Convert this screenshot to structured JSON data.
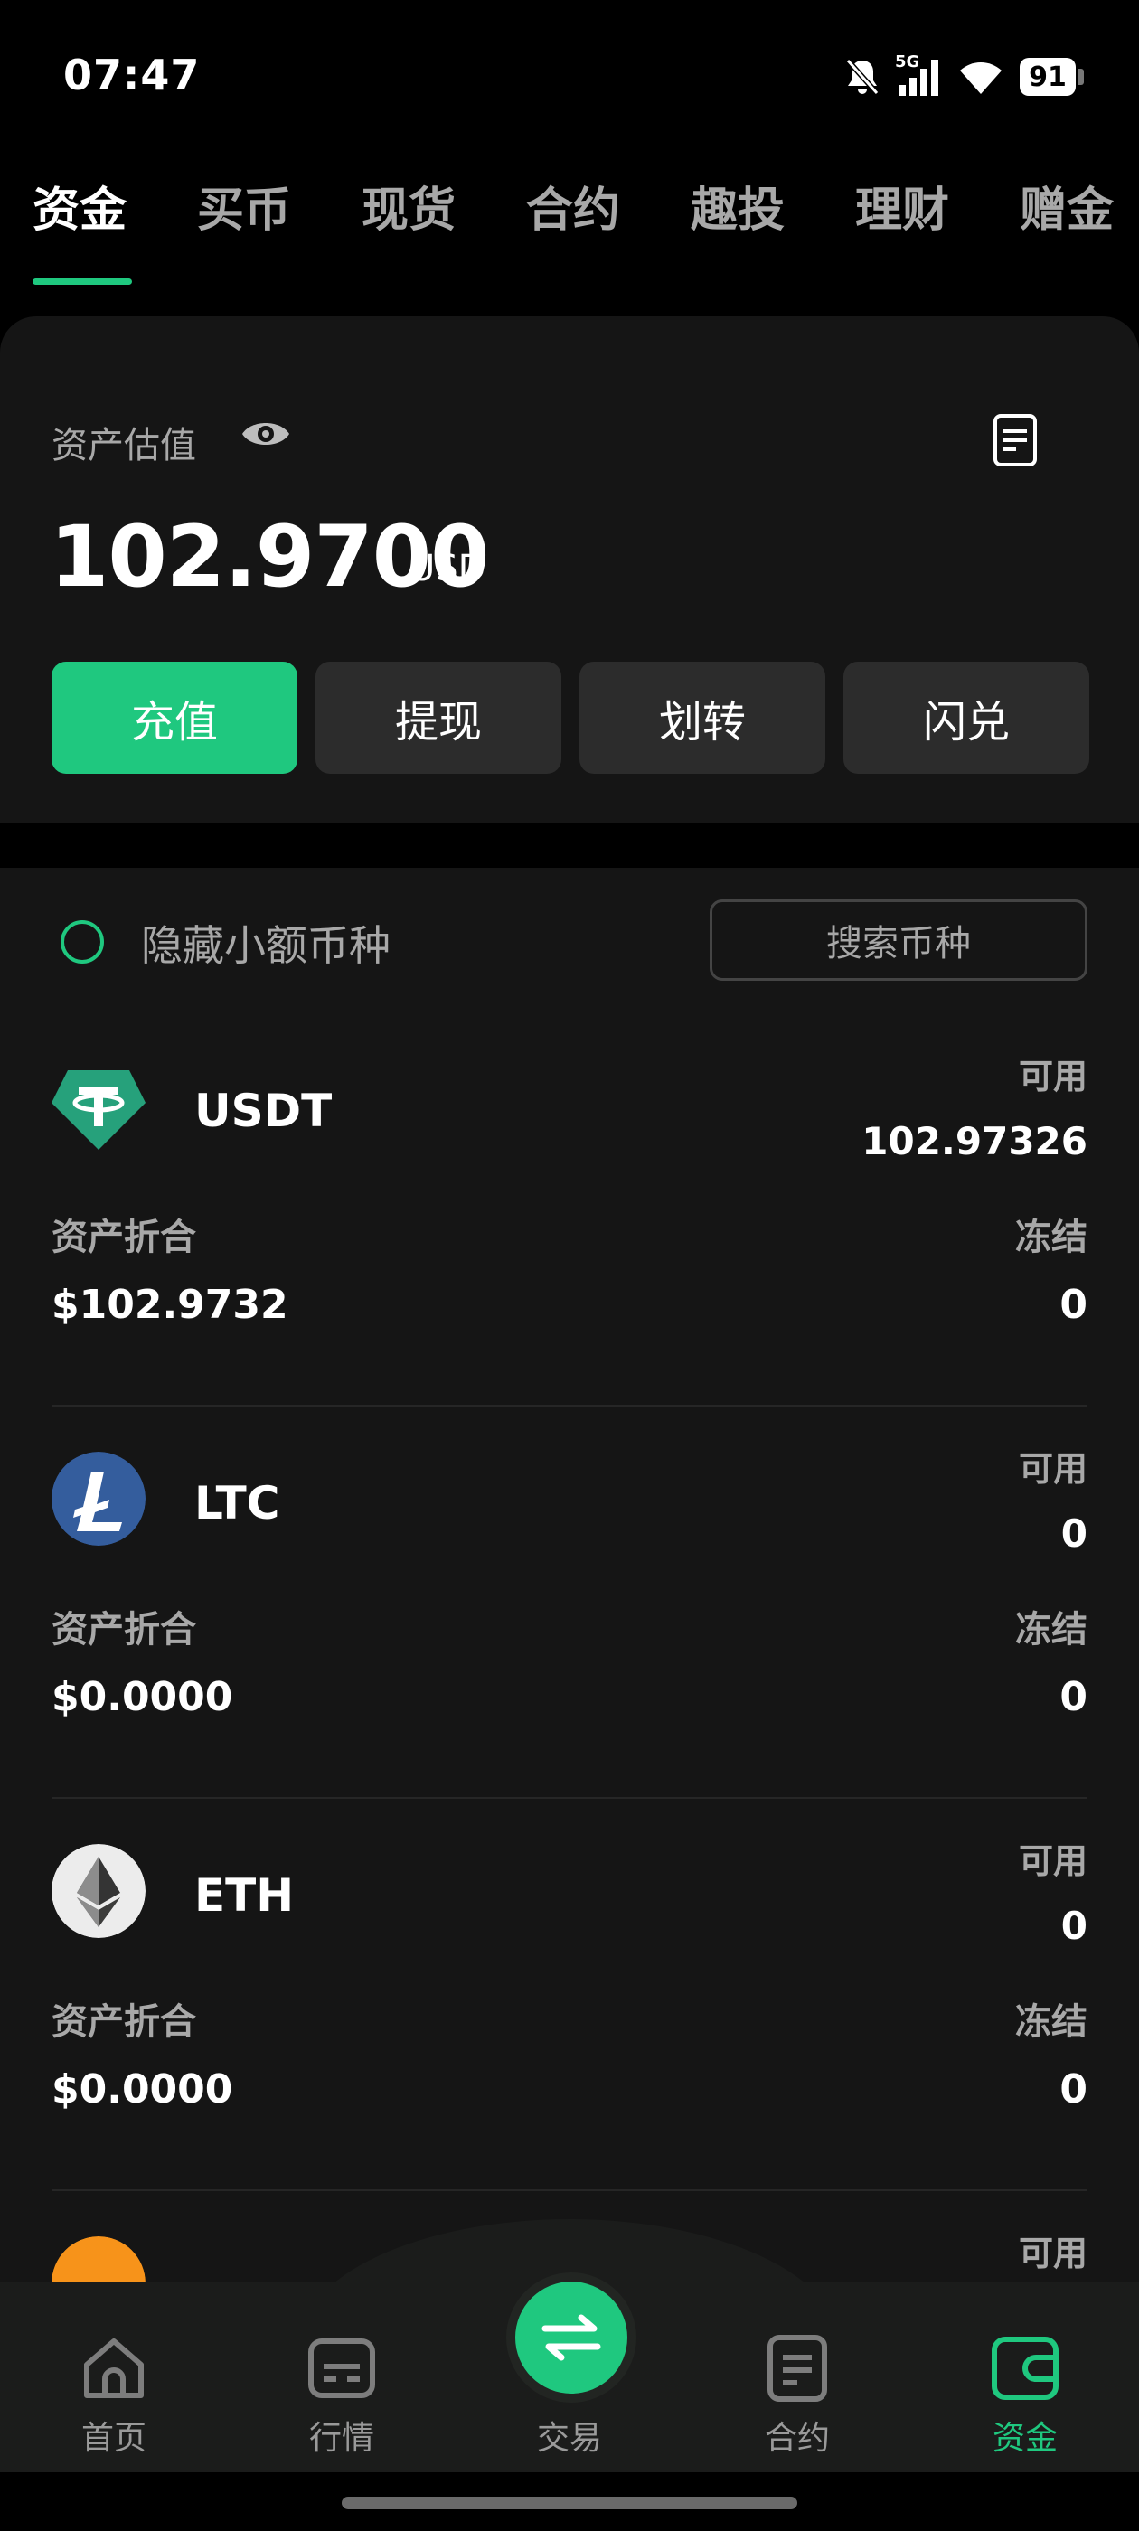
{
  "status_bar": {
    "time": "07:47",
    "network": "5G",
    "battery": "91",
    "icons": [
      "bell-off-icon",
      "signal-icon",
      "wifi-icon",
      "battery-icon"
    ]
  },
  "tabs": [
    {
      "label": "资金",
      "active": true
    },
    {
      "label": "买币"
    },
    {
      "label": "现货"
    },
    {
      "label": "合约"
    },
    {
      "label": "趣投"
    },
    {
      "label": "理财"
    },
    {
      "label": "赠金"
    }
  ],
  "asset": {
    "label": "资产估值",
    "amount": "102.9700",
    "unit": "USD",
    "buttons": [
      "充值",
      "提现",
      "划转",
      "闪兑"
    ]
  },
  "list": {
    "hide_small_label": "隐藏小额币种",
    "search_label": "搜索币种",
    "coins": [
      {
        "name": "USDT",
        "available_label": "可用",
        "available": "102.97326",
        "converted_label": "资产折合",
        "converted": "$102.9732",
        "frozen_label": "冻结",
        "frozen": "0"
      },
      {
        "name": "LTC",
        "available_label": "可用",
        "available": "0",
        "converted_label": "资产折合",
        "converted": "$0.0000",
        "frozen_label": "冻结",
        "frozen": "0"
      },
      {
        "name": "ETH",
        "available_label": "可用",
        "available": "0",
        "converted_label": "资产折合",
        "converted": "$0.0000",
        "frozen_label": "冻结",
        "frozen": "0"
      },
      {
        "name": "",
        "available_label": "可用"
      }
    ]
  },
  "nav": {
    "items": [
      "首页",
      "行情",
      "交易",
      "合约",
      "资金"
    ],
    "active": "资金"
  },
  "colors": {
    "accent": "#1fc87f",
    "background": "#000000",
    "card": "#151515",
    "button": "#2c2c2c"
  }
}
